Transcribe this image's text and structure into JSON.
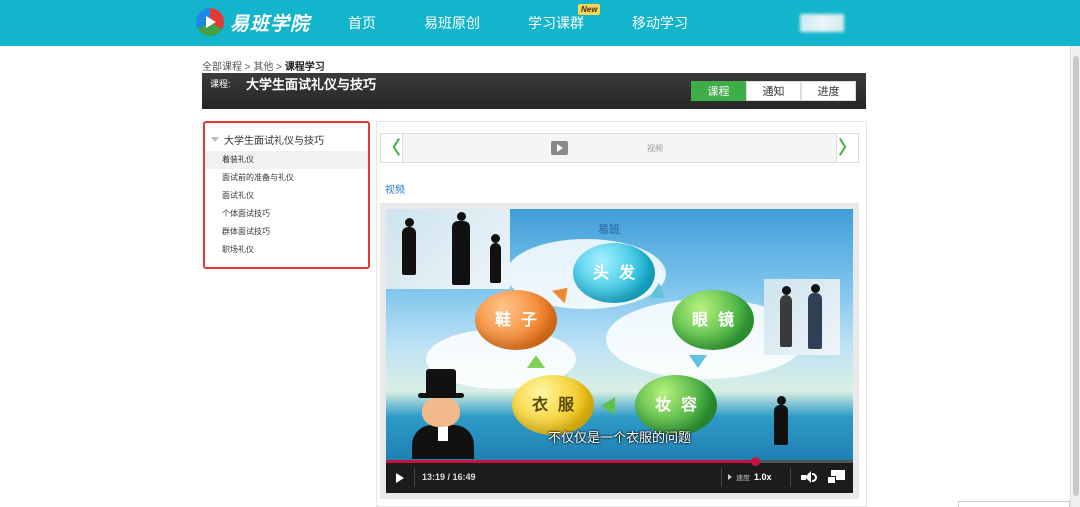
{
  "header": {
    "logo_text": "易班学院",
    "nav": [
      {
        "label": "首页"
      },
      {
        "label": "易班原创"
      },
      {
        "label": "学习课群",
        "badge": "New"
      },
      {
        "label": "移动学习"
      }
    ]
  },
  "breadcrumb": {
    "items": [
      "全部课程",
      "其他"
    ],
    "separator": ">",
    "current": "课程学习"
  },
  "course": {
    "label": "课程:",
    "title": "大学生面试礼仪与技巧",
    "tabs": [
      {
        "label": "课程",
        "active": true
      },
      {
        "label": "通知",
        "active": false
      },
      {
        "label": "进度",
        "active": false
      }
    ]
  },
  "sidebar": {
    "heading": "大学生面试礼仪与技巧",
    "items": [
      {
        "label": "着装礼仪",
        "active": true
      },
      {
        "label": "面试前的准备与礼仪",
        "active": false
      },
      {
        "label": "面试礼仪",
        "active": false
      },
      {
        "label": "个体面试技巧",
        "active": false
      },
      {
        "label": "群体面试技巧",
        "active": false
      },
      {
        "label": "职场礼仪",
        "active": false
      }
    ]
  },
  "pager": {
    "prev_symbol": "〈",
    "next_symbol": "〉",
    "item_label": "视频"
  },
  "section_title": "视频",
  "video": {
    "watermark": "易班",
    "bubbles": {
      "hair": "头发",
      "glasses": "眼镜",
      "makeup": "妆容",
      "clothes": "衣服",
      "shoes": "鞋子"
    },
    "subtitle": "不仅仅是一个衣服的问题",
    "time_display": "13:19 / 16:49",
    "progress_fraction": 0.79,
    "speed_label": "速度",
    "speed_value": "1.0x"
  },
  "colors": {
    "topbar": "#12b5cb",
    "accent_green": "#3fae49",
    "sidebar_border": "#e53935",
    "link_blue": "#2b7fc3",
    "progress": "#c8143c"
  }
}
